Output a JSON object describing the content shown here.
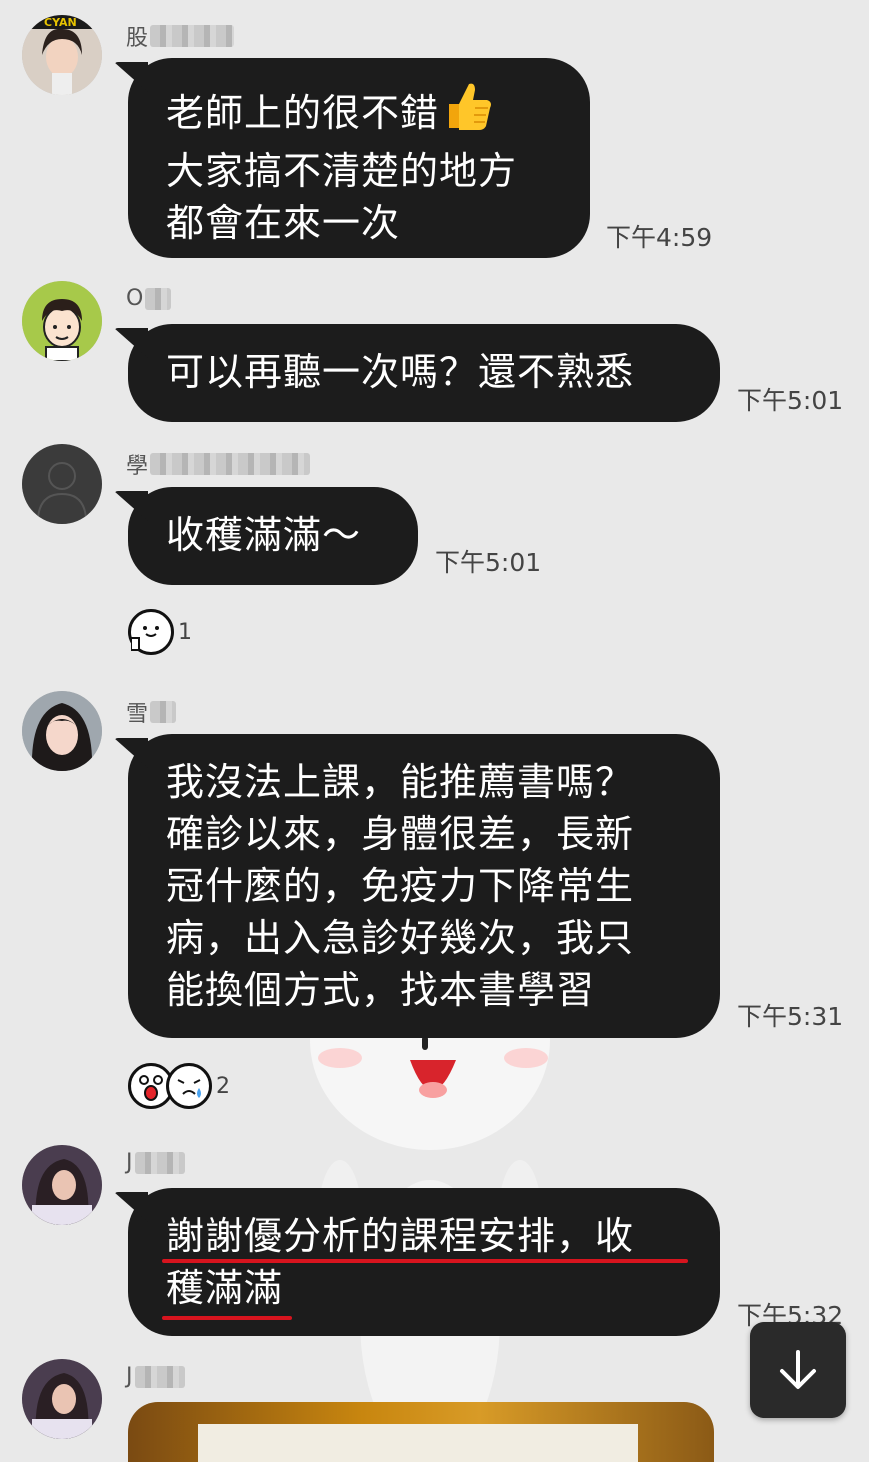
{
  "messages": [
    {
      "sender": "股",
      "lines": [
        "老師上的很不錯",
        "大家搞不清楚的地方",
        "都會在來一次"
      ],
      "time": "下午4:59"
    },
    {
      "sender": "O",
      "lines": [
        "可以再聽一次嗎？還不熟悉"
      ],
      "time": "下午5:01"
    },
    {
      "sender": "學",
      "lines": [
        "收穫滿滿～"
      ],
      "time": "下午5:01",
      "reaction": {
        "icons": [
          "thumbs-up-face-icon"
        ],
        "count": "1"
      }
    },
    {
      "sender": "雪",
      "lines": [
        "我沒法上課，能推薦書嗎？",
        "確診以來，身體很差，長新",
        "冠什麼的，免疫力下降常生",
        "病，出入急診好幾次，我只",
        "能換個方式，找本書學習"
      ],
      "time": "下午5:31",
      "reaction": {
        "icons": [
          "surprised-face-icon",
          "crying-face-icon"
        ],
        "count": "2"
      }
    },
    {
      "sender": "J",
      "lines": [
        "謝謝優分析的課程安排，收",
        "穫滿滿"
      ],
      "time": "下午5:32",
      "highlight": "#d7141e"
    },
    {
      "sender": "J",
      "lines": [],
      "attachment": "image"
    }
  ],
  "scroll_button": {
    "icon": "arrow-down-icon"
  }
}
